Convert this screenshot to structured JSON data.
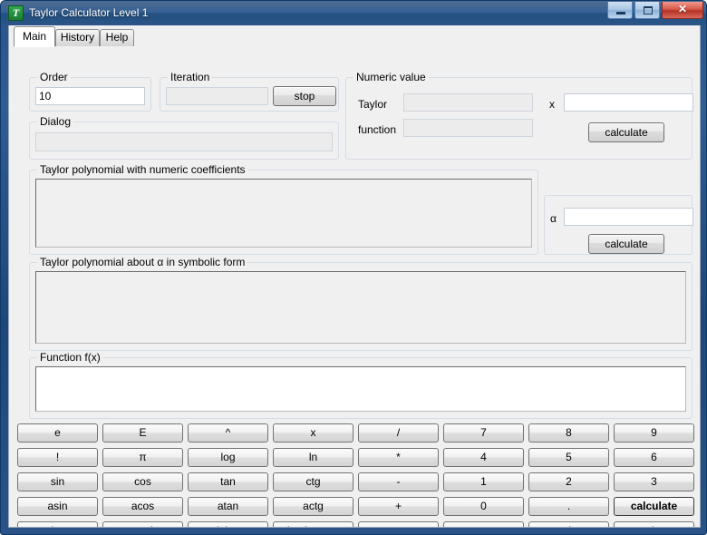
{
  "window": {
    "title": "Taylor Calculator Level 1",
    "app_icon": "taylor-app-icon",
    "minimize_label": "Minimize",
    "maximize_label": "Maximize",
    "close_label": "✕"
  },
  "tabs": [
    {
      "label": "Main",
      "active": true
    },
    {
      "label": "History",
      "active": false
    },
    {
      "label": "Help",
      "active": false
    }
  ],
  "groups": {
    "order": {
      "label": "Order"
    },
    "iteration": {
      "label": "Iteration"
    },
    "dialog": {
      "label": "Dialog"
    },
    "numeric_value": {
      "label": "Numeric value"
    },
    "taylor_numeric": {
      "label": "Taylor polynomial with numeric coefficients"
    },
    "alpha_panel": {
      "label": ""
    },
    "taylor_symbolic": {
      "label": "Taylor polynomial about α in symbolic form"
    },
    "function": {
      "label": "Function f(x)"
    }
  },
  "fields": {
    "order": {
      "value": "10",
      "placeholder": ""
    },
    "iteration": {
      "value": "",
      "placeholder": ""
    },
    "dialog": {
      "value": "",
      "placeholder": ""
    },
    "taylor_numeric_value": {
      "value": "",
      "placeholder": ""
    },
    "function_numeric_value": {
      "value": "",
      "placeholder": ""
    },
    "x": {
      "value": "",
      "placeholder": ""
    },
    "alpha": {
      "value": "",
      "placeholder": ""
    },
    "taylor_numeric_output": {
      "value": ""
    },
    "taylor_symbolic_output": {
      "value": ""
    },
    "function_input": {
      "value": "",
      "placeholder": ""
    }
  },
  "labels": {
    "taylor": "Taylor",
    "function": "function",
    "x": "x",
    "alpha": "α"
  },
  "buttons": {
    "stop": "stop",
    "calculate_numeric": "calculate",
    "calculate_alpha": "calculate"
  },
  "keypad": {
    "rows": [
      [
        {
          "label": "e",
          "name": "key-e",
          "bold": false
        },
        {
          "label": "E",
          "name": "key-E",
          "bold": false
        },
        {
          "label": "^",
          "name": "key-power",
          "bold": false
        },
        {
          "label": "x",
          "name": "key-x",
          "bold": false
        },
        {
          "label": "/",
          "name": "key-divide",
          "bold": false
        },
        {
          "label": "7",
          "name": "key-7",
          "bold": false
        },
        {
          "label": "8",
          "name": "key-8",
          "bold": false
        },
        {
          "label": "9",
          "name": "key-9",
          "bold": false
        }
      ],
      [
        {
          "label": "!",
          "name": "key-factorial",
          "bold": false
        },
        {
          "label": "π",
          "name": "key-pi",
          "bold": false
        },
        {
          "label": "log",
          "name": "key-log",
          "bold": false
        },
        {
          "label": "ln",
          "name": "key-ln",
          "bold": false
        },
        {
          "label": "*",
          "name": "key-multiply",
          "bold": false
        },
        {
          "label": "4",
          "name": "key-4",
          "bold": false
        },
        {
          "label": "5",
          "name": "key-5",
          "bold": false
        },
        {
          "label": "6",
          "name": "key-6",
          "bold": false
        }
      ],
      [
        {
          "label": "sin",
          "name": "key-sin",
          "bold": false
        },
        {
          "label": "cos",
          "name": "key-cos",
          "bold": false
        },
        {
          "label": "tan",
          "name": "key-tan",
          "bold": false
        },
        {
          "label": "ctg",
          "name": "key-ctg",
          "bold": false
        },
        {
          "label": "-",
          "name": "key-minus",
          "bold": false
        },
        {
          "label": "1",
          "name": "key-1",
          "bold": false
        },
        {
          "label": "2",
          "name": "key-2",
          "bold": false
        },
        {
          "label": "3",
          "name": "key-3",
          "bold": false
        }
      ],
      [
        {
          "label": "asin",
          "name": "key-asin",
          "bold": false
        },
        {
          "label": "acos",
          "name": "key-acos",
          "bold": false
        },
        {
          "label": "atan",
          "name": "key-atan",
          "bold": false
        },
        {
          "label": "actg",
          "name": "key-actg",
          "bold": false
        },
        {
          "label": "+",
          "name": "key-plus",
          "bold": false
        },
        {
          "label": "0",
          "name": "key-0",
          "bold": false
        },
        {
          "label": ".",
          "name": "key-decimal-point",
          "bold": false
        },
        {
          "label": "calculate",
          "name": "key-calculate",
          "bold": true
        }
      ],
      [
        {
          "label": "clear",
          "name": "key-clear",
          "bold": false
        },
        {
          "label": "result",
          "name": "key-result",
          "bold": false
        },
        {
          "label": "delete",
          "name": "key-delete",
          "bold": false
        },
        {
          "label": "backspace",
          "name": "key-backspace",
          "bold": false
        },
        {
          "label": "<--",
          "name": "key-cursor-left",
          "bold": false
        },
        {
          "label": "-->",
          "name": "key-cursor-right",
          "bold": false
        },
        {
          "label": "(",
          "name": "key-paren-open",
          "bold": false
        },
        {
          "label": ")",
          "name": "key-paren-close",
          "bold": false
        }
      ]
    ]
  },
  "colors": {
    "titlebar": "#2b5489",
    "client_bg": "#f0f0f0",
    "close_button": "#c0392b",
    "accent": "#2b5489"
  }
}
